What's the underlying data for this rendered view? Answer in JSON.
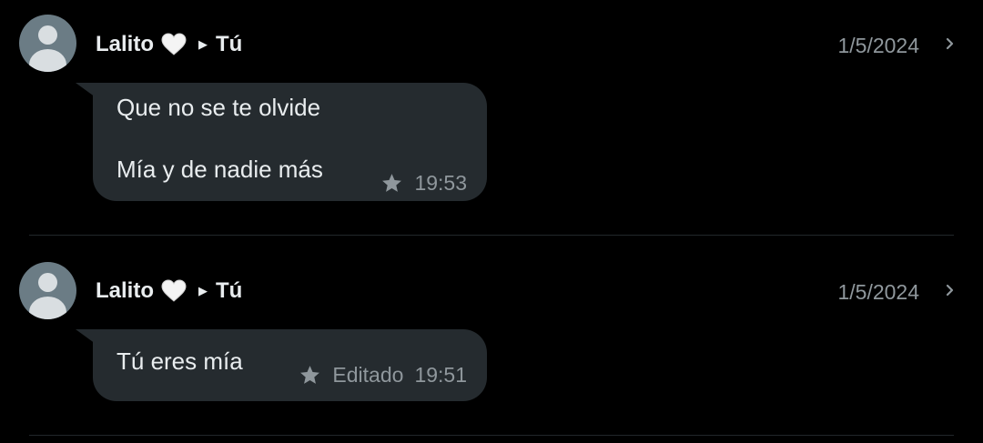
{
  "messages": [
    {
      "sender": "Lalito",
      "sender_emoji": "🤍",
      "recipient": "Tú",
      "date": "1/5/2024",
      "lines": [
        "Que no se te olvide",
        "Mía y de nadie más"
      ],
      "starred": true,
      "edited_label": "",
      "time": "19:53"
    },
    {
      "sender": "Lalito",
      "sender_emoji": "🤍",
      "recipient": "Tú",
      "date": "1/5/2024",
      "lines": [
        "Tú eres mía"
      ],
      "starred": true,
      "edited_label": "Editado",
      "time": "19:51"
    }
  ],
  "icons": {
    "avatar": "default-avatar-icon",
    "heart": "white-heart-icon",
    "arrow": "play-arrow-icon",
    "chevron": "chevron-right-icon",
    "star": "star-icon"
  },
  "colors": {
    "background": "#000000",
    "bubble": "#252b2f",
    "primary_text": "#e9edef",
    "secondary_text": "#8f979c",
    "avatar_bg": "#6b7c85"
  }
}
